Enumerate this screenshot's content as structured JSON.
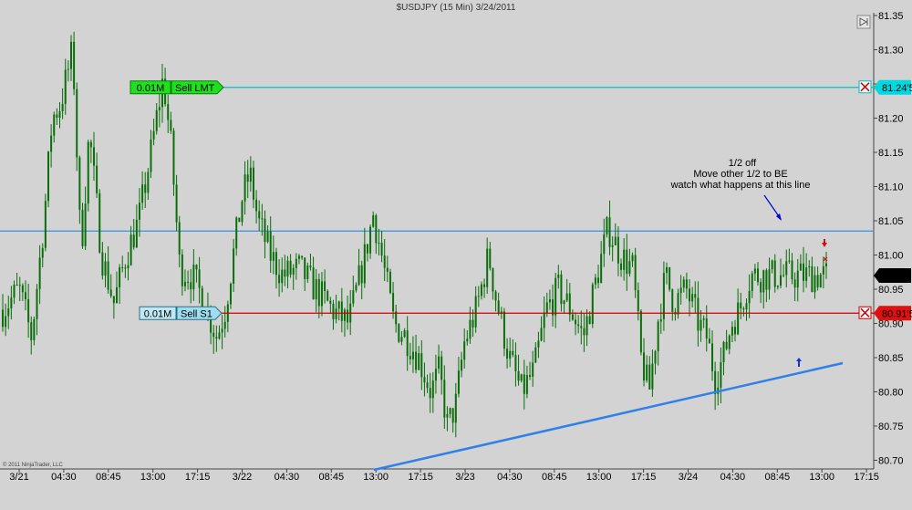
{
  "chart_data": {
    "type": "candlestick",
    "title": "$USDJPY (15 Min)  3/24/2011",
    "y_axis": {
      "range": [
        80.66,
        81.36
      ],
      "ticks": [
        "81.35",
        "81.30",
        "81.25",
        "81.20",
        "81.15",
        "81.10",
        "81.05",
        "81.00",
        "80.95",
        "80.90",
        "80.85",
        "80.80",
        "80.75",
        "80.70"
      ]
    },
    "x_axis": {
      "ticks": [
        "3/21",
        "04:30",
        "08:45",
        "13:00",
        "17:15",
        "3/22",
        "04:30",
        "08:45",
        "13:00",
        "17:15",
        "3/23",
        "04:30",
        "08:45",
        "13:00",
        "17:15",
        "3/24",
        "04:30",
        "08:45",
        "13:00",
        "17:15"
      ]
    },
    "orders": [
      {
        "qty": "0.01M",
        "label": "Sell LMT",
        "price_label": "81.24'5",
        "price": 81.245,
        "color": "#00c0c0"
      },
      {
        "qty": "0.01M",
        "label": "Sell S1",
        "price_label": "80.91'5",
        "price": 80.915,
        "color": "#d00000"
      }
    ],
    "horizontal_line": {
      "price": 81.035,
      "color": "#3a8fe0"
    },
    "trendline": {
      "from": [
        "3/22 13:00",
        80.665
      ],
      "to": [
        "3/24 13:30",
        80.83
      ],
      "color": "#2f80e8"
    },
    "last_price_label": "80.97",
    "annotation": [
      "1/2 off",
      "Move other 1/2 to BE",
      "watch what happens at this line"
    ],
    "copyright": "© 2011 NinjaTrader, LLC",
    "candle_color": "#0a6e0a",
    "path": [
      [
        0,
        80.92
      ],
      [
        0.02,
        80.95
      ],
      [
        0.035,
        80.88
      ],
      [
        0.05,
        81.05
      ],
      [
        0.06,
        81.2
      ],
      [
        0.07,
        81.22
      ],
      [
        0.085,
        81.3
      ],
      [
        0.095,
        81.0
      ],
      [
        0.105,
        81.18
      ],
      [
        0.12,
        81.0
      ],
      [
        0.135,
        80.93
      ],
      [
        0.15,
        81.0
      ],
      [
        0.165,
        81.05
      ],
      [
        0.18,
        81.15
      ],
      [
        0.195,
        81.26
      ],
      [
        0.205,
        81.15
      ],
      [
        0.215,
        80.98
      ],
      [
        0.23,
        80.97
      ],
      [
        0.245,
        80.93
      ],
      [
        0.26,
        80.88
      ],
      [
        0.27,
        80.92
      ],
      [
        0.28,
        81.0
      ],
      [
        0.29,
        81.08
      ],
      [
        0.3,
        81.12
      ],
      [
        0.31,
        81.05
      ],
      [
        0.325,
        81.0
      ],
      [
        0.34,
        80.97
      ],
      [
        0.36,
        80.98
      ],
      [
        0.38,
        80.95
      ],
      [
        0.4,
        80.92
      ],
      [
        0.42,
        80.9
      ],
      [
        0.44,
        81.0
      ],
      [
        0.45,
        81.06
      ],
      [
        0.46,
        81.0
      ],
      [
        0.475,
        80.9
      ],
      [
        0.49,
        80.88
      ],
      [
        0.505,
        80.85
      ],
      [
        0.52,
        80.8
      ],
      [
        0.53,
        80.83
      ],
      [
        0.54,
        80.75
      ],
      [
        0.55,
        80.78
      ],
      [
        0.56,
        80.87
      ],
      [
        0.575,
        80.92
      ],
      [
        0.59,
        81.0
      ],
      [
        0.6,
        80.93
      ],
      [
        0.615,
        80.85
      ],
      [
        0.63,
        80.8
      ],
      [
        0.645,
        80.83
      ],
      [
        0.66,
        80.92
      ],
      [
        0.675,
        80.95
      ],
      [
        0.69,
        80.92
      ],
      [
        0.705,
        80.88
      ],
      [
        0.72,
        80.96
      ],
      [
        0.735,
        81.04
      ],
      [
        0.75,
        81.0
      ],
      [
        0.765,
        80.98
      ],
      [
        0.775,
        80.85
      ],
      [
        0.785,
        80.8
      ],
      [
        0.795,
        80.9
      ],
      [
        0.805,
        80.97
      ],
      [
        0.815,
        80.93
      ],
      [
        0.83,
        80.95
      ],
      [
        0.845,
        80.9
      ],
      [
        0.855,
        80.88
      ],
      [
        0.865,
        80.82
      ],
      [
        0.875,
        80.85
      ],
      [
        0.885,
        80.9
      ],
      [
        0.895,
        80.92
      ],
      [
        0.905,
        80.96
      ],
      [
        0.91,
        80.97
      ]
    ]
  }
}
